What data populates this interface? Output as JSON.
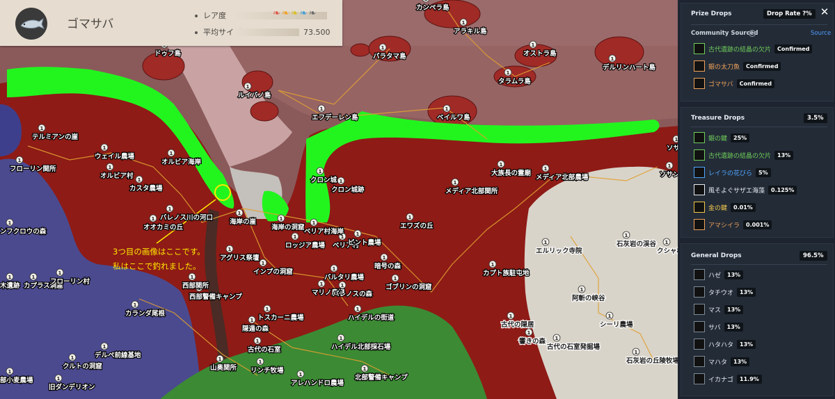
{
  "fish": {
    "name": "ゴマサバ",
    "rarity_label": "レア度",
    "avg_size_label": "平均サイズ",
    "avg_size_value": "73.500",
    "rarity_level": 5
  },
  "annotation": {
    "line1": "3つ目の画像はここです。",
    "line2": "私はここで釣れました。"
  },
  "map": {
    "node_marker": "1",
    "regions": {
      "ocean": "#8a5a5a",
      "land_red": "#8e1b16",
      "land_blue": "#4b4a8f",
      "land_green": "#3c8a34",
      "land_grey": "#d9d4ca",
      "fishing_zone": "#22f51e"
    },
    "place_names": [
      "カンペラ島",
      "アラキル島",
      "ドゥフ島",
      "パラタマ島",
      "オストラ島",
      "デルリンハート島",
      "ルイバノ島",
      "タラムラ島",
      "エフデーレン島",
      "ベイルワ島",
      "テルミアンの崖",
      "ウェイル農場",
      "フローリン関所",
      "オルビア村",
      "オルビア海岸",
      "カスタ農場",
      "クロン城",
      "クロン城跡",
      "大族長の霊廟",
      "メディア北部農場",
      "メディア北部関所",
      "ソサンの丘",
      "ソサン駐屯地",
      "バレノス川の河口",
      "オオカミの丘",
      "ンフクロウの森",
      "海岸の崖",
      "海岸の洞窟",
      "ベリア村海岸",
      "ベリア村",
      "エワズの丘",
      "ロッジア農場",
      "ピント農場",
      "アグリス祭壇",
      "インプの洞窟",
      "暗号の森",
      "バルタリ農場",
      "マリノ農場",
      "バレノスの森",
      "ゴブリンの洞窟",
      "西部関所",
      "西部警備キャンプ",
      "木遺跡",
      "カプラス洞窟",
      "フローリン村",
      "カランダ尾根",
      "トスカーニ農場",
      "ハイデルの街道",
      "古代の石室",
      "隠遁の森",
      "山奥関所",
      "リンチ牧場",
      "デルペ前線基地",
      "クルトの洞窟",
      "旧ダンデリオン",
      "部小麦農場",
      "ハイデル北部採石場",
      "北部警備キャンプ",
      "アレハンドロ農場",
      "カプト族駐屯地",
      "エルリック寺院",
      "石灰岩の渓谷",
      "クシャ村",
      "古代の隠居",
      "響きの森",
      "古代の石室発掘場",
      "阿斬の峡谷",
      "シーリ農場",
      "石灰岩の丘陵牧場"
    ]
  },
  "panel": {
    "close_icon": "close-icon",
    "prize": {
      "title": "Prize Drops",
      "rate": "Drop Rate ?%",
      "community": "Community Sourced",
      "source": "Source",
      "items": [
        {
          "name": "古代遺跡の結晶の欠片",
          "value": "Confirmed",
          "color": "#6fcf5a"
        },
        {
          "name": "銀の太刀魚",
          "value": "Confirmed",
          "color": "#f0a35a"
        },
        {
          "name": "ゴマサバ",
          "value": "Confirmed",
          "color": "#f0a35a"
        }
      ]
    },
    "treasure": {
      "title": "Treasure Drops",
      "rate": "3.5%",
      "items": [
        {
          "name": "銀の鍵",
          "value": "25%",
          "color": "#6fcf5a"
        },
        {
          "name": "古代遺跡の結晶の欠片",
          "value": "13%",
          "color": "#6fcf5a"
        },
        {
          "name": "レイラの花びら",
          "value": "5%",
          "color": "#4fa7ff"
        },
        {
          "name": "風そよぐサザエ海藻",
          "value": "0.125%",
          "color": "#e8edf3"
        },
        {
          "name": "金の鍵",
          "value": "0.01%",
          "color": "#f2c94c"
        },
        {
          "name": "アマシイラ",
          "value": "0.001%",
          "color": "#f0a35a"
        }
      ]
    },
    "general": {
      "title": "General Drops",
      "rate": "96.5%",
      "items": [
        {
          "name": "ハゼ",
          "value": "13%"
        },
        {
          "name": "タチウオ",
          "value": "13%"
        },
        {
          "name": "マス",
          "value": "13%"
        },
        {
          "name": "サバ",
          "value": "13%"
        },
        {
          "name": "ハタハタ",
          "value": "13%"
        },
        {
          "name": "マハタ",
          "value": "13%"
        },
        {
          "name": "イカナゴ",
          "value": "11.9%"
        }
      ]
    }
  }
}
